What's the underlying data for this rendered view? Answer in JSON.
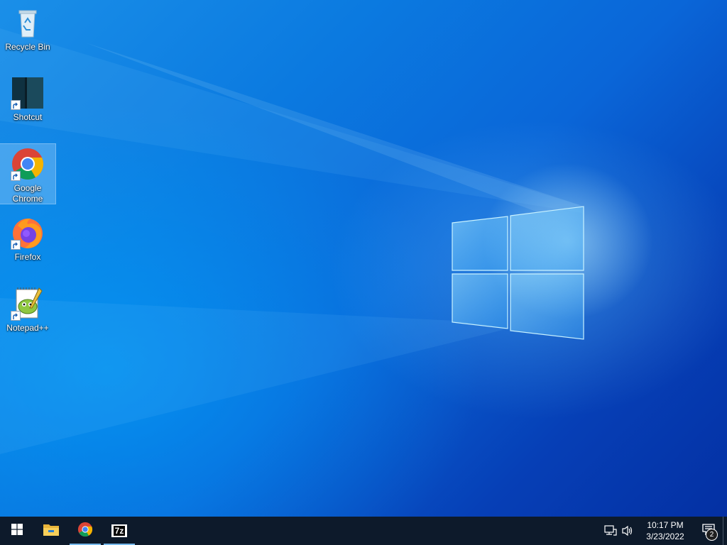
{
  "desktop": {
    "icons": [
      {
        "label": "Recycle Bin",
        "icon": "recycle-bin-icon",
        "shortcut": false
      },
      {
        "label": "Shotcut",
        "icon": "shotcut-icon",
        "shortcut": true
      },
      {
        "label": "Google Chrome",
        "icon": "chrome-icon",
        "shortcut": true,
        "selected": true
      },
      {
        "label": "Firefox",
        "icon": "firefox-icon",
        "shortcut": true
      },
      {
        "label": "Notepad++",
        "icon": "notepadpp-icon",
        "shortcut": true
      }
    ]
  },
  "taskbar": {
    "start_icon": "windows-start-icon",
    "pinned": [
      {
        "name": "File Explorer",
        "icon": "file-explorer-icon"
      },
      {
        "name": "Google Chrome",
        "icon": "chrome-icon",
        "running": true
      },
      {
        "name": "7-Zip",
        "icon": "7zip-icon",
        "running": true,
        "text": "7z"
      }
    ],
    "tray": {
      "network_icon": "network-icon",
      "volume_icon": "volume-icon",
      "time": "10:17 PM",
      "date": "3/23/2022",
      "notification_count": "2"
    }
  },
  "colors": {
    "taskbar_bg": "#0d1a2b",
    "desktop_blue": "#0a66d8",
    "accent": "#76b9ed"
  }
}
